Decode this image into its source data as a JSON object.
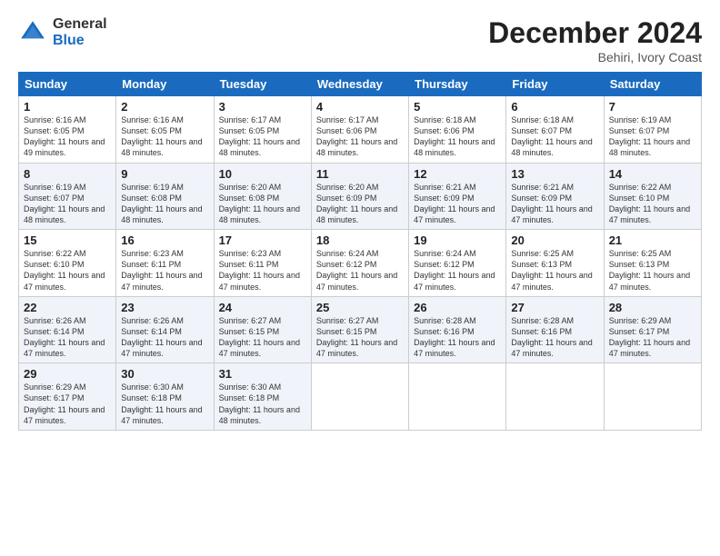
{
  "logo": {
    "general": "General",
    "blue": "Blue"
  },
  "header": {
    "month": "December 2024",
    "location": "Behiri, Ivory Coast"
  },
  "days_of_week": [
    "Sunday",
    "Monday",
    "Tuesday",
    "Wednesday",
    "Thursday",
    "Friday",
    "Saturday"
  ],
  "weeks": [
    [
      {
        "day": "1",
        "info": "Sunrise: 6:16 AM\nSunset: 6:05 PM\nDaylight: 11 hours and 49 minutes."
      },
      {
        "day": "2",
        "info": "Sunrise: 6:16 AM\nSunset: 6:05 PM\nDaylight: 11 hours and 48 minutes."
      },
      {
        "day": "3",
        "info": "Sunrise: 6:17 AM\nSunset: 6:05 PM\nDaylight: 11 hours and 48 minutes."
      },
      {
        "day": "4",
        "info": "Sunrise: 6:17 AM\nSunset: 6:06 PM\nDaylight: 11 hours and 48 minutes."
      },
      {
        "day": "5",
        "info": "Sunrise: 6:18 AM\nSunset: 6:06 PM\nDaylight: 11 hours and 48 minutes."
      },
      {
        "day": "6",
        "info": "Sunrise: 6:18 AM\nSunset: 6:07 PM\nDaylight: 11 hours and 48 minutes."
      },
      {
        "day": "7",
        "info": "Sunrise: 6:19 AM\nSunset: 6:07 PM\nDaylight: 11 hours and 48 minutes."
      }
    ],
    [
      {
        "day": "8",
        "info": "Sunrise: 6:19 AM\nSunset: 6:07 PM\nDaylight: 11 hours and 48 minutes."
      },
      {
        "day": "9",
        "info": "Sunrise: 6:19 AM\nSunset: 6:08 PM\nDaylight: 11 hours and 48 minutes."
      },
      {
        "day": "10",
        "info": "Sunrise: 6:20 AM\nSunset: 6:08 PM\nDaylight: 11 hours and 48 minutes."
      },
      {
        "day": "11",
        "info": "Sunrise: 6:20 AM\nSunset: 6:09 PM\nDaylight: 11 hours and 48 minutes."
      },
      {
        "day": "12",
        "info": "Sunrise: 6:21 AM\nSunset: 6:09 PM\nDaylight: 11 hours and 47 minutes."
      },
      {
        "day": "13",
        "info": "Sunrise: 6:21 AM\nSunset: 6:09 PM\nDaylight: 11 hours and 47 minutes."
      },
      {
        "day": "14",
        "info": "Sunrise: 6:22 AM\nSunset: 6:10 PM\nDaylight: 11 hours and 47 minutes."
      }
    ],
    [
      {
        "day": "15",
        "info": "Sunrise: 6:22 AM\nSunset: 6:10 PM\nDaylight: 11 hours and 47 minutes."
      },
      {
        "day": "16",
        "info": "Sunrise: 6:23 AM\nSunset: 6:11 PM\nDaylight: 11 hours and 47 minutes."
      },
      {
        "day": "17",
        "info": "Sunrise: 6:23 AM\nSunset: 6:11 PM\nDaylight: 11 hours and 47 minutes."
      },
      {
        "day": "18",
        "info": "Sunrise: 6:24 AM\nSunset: 6:12 PM\nDaylight: 11 hours and 47 minutes."
      },
      {
        "day": "19",
        "info": "Sunrise: 6:24 AM\nSunset: 6:12 PM\nDaylight: 11 hours and 47 minutes."
      },
      {
        "day": "20",
        "info": "Sunrise: 6:25 AM\nSunset: 6:13 PM\nDaylight: 11 hours and 47 minutes."
      },
      {
        "day": "21",
        "info": "Sunrise: 6:25 AM\nSunset: 6:13 PM\nDaylight: 11 hours and 47 minutes."
      }
    ],
    [
      {
        "day": "22",
        "info": "Sunrise: 6:26 AM\nSunset: 6:14 PM\nDaylight: 11 hours and 47 minutes."
      },
      {
        "day": "23",
        "info": "Sunrise: 6:26 AM\nSunset: 6:14 PM\nDaylight: 11 hours and 47 minutes."
      },
      {
        "day": "24",
        "info": "Sunrise: 6:27 AM\nSunset: 6:15 PM\nDaylight: 11 hours and 47 minutes."
      },
      {
        "day": "25",
        "info": "Sunrise: 6:27 AM\nSunset: 6:15 PM\nDaylight: 11 hours and 47 minutes."
      },
      {
        "day": "26",
        "info": "Sunrise: 6:28 AM\nSunset: 6:16 PM\nDaylight: 11 hours and 47 minutes."
      },
      {
        "day": "27",
        "info": "Sunrise: 6:28 AM\nSunset: 6:16 PM\nDaylight: 11 hours and 47 minutes."
      },
      {
        "day": "28",
        "info": "Sunrise: 6:29 AM\nSunset: 6:17 PM\nDaylight: 11 hours and 47 minutes."
      }
    ],
    [
      {
        "day": "29",
        "info": "Sunrise: 6:29 AM\nSunset: 6:17 PM\nDaylight: 11 hours and 47 minutes."
      },
      {
        "day": "30",
        "info": "Sunrise: 6:30 AM\nSunset: 6:18 PM\nDaylight: 11 hours and 47 minutes."
      },
      {
        "day": "31",
        "info": "Sunrise: 6:30 AM\nSunset: 6:18 PM\nDaylight: 11 hours and 48 minutes."
      },
      null,
      null,
      null,
      null
    ]
  ]
}
